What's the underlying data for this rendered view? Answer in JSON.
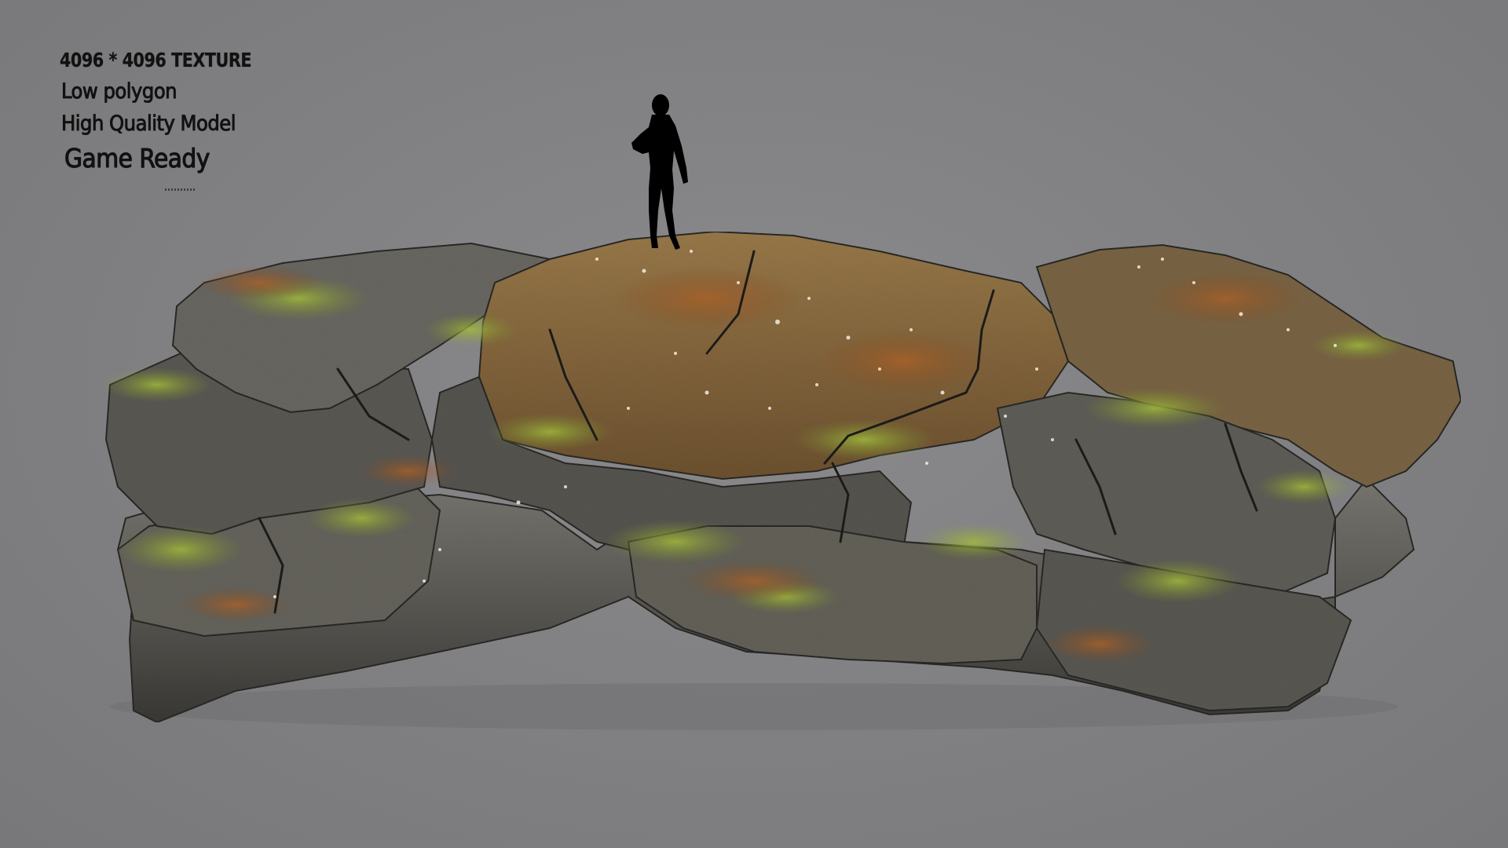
{
  "overlay_text": {
    "texture": "4096 * 4096 TEXTURE",
    "polygon": "Low polygon",
    "quality": "High Quality Model",
    "ready": "Game Ready"
  },
  "colors": {
    "background": "#808082",
    "rock_gray": "#5f5f5c",
    "rock_dark": "#2e2d2a",
    "moss_green": "#8fa83a",
    "rust_orange": "#a8642a",
    "silhouette": "#000000"
  },
  "scene": {
    "model": "mossy-rock-formation",
    "scale_reference": "human-silhouette"
  }
}
